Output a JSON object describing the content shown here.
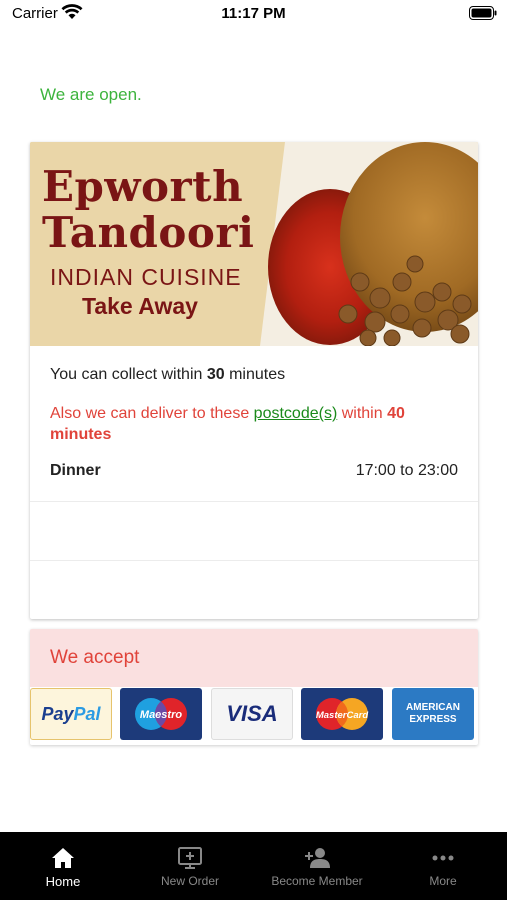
{
  "status_bar": {
    "carrier": "Carrier",
    "time": "11:17 PM"
  },
  "open_status": "We are open.",
  "restaurant": {
    "name_line1": "Epworth",
    "name_line2": "Tandoori",
    "subtitle": "INDIAN CUISINE",
    "tagline": "Take Away"
  },
  "collect": {
    "prefix": "You can collect within ",
    "minutes": "30",
    "suffix": " minutes"
  },
  "delivery": {
    "prefix": "Also we can deliver to these ",
    "link_text": "postcode(s)",
    "middle": " within ",
    "minutes": "40 minutes"
  },
  "hours": [
    {
      "label": "Dinner",
      "time": "17:00 to 23:00"
    }
  ],
  "payment": {
    "title": "We accept",
    "methods": [
      {
        "name": "PayPal",
        "part1": "Pay",
        "part2": "Pal"
      },
      {
        "name": "Maestro"
      },
      {
        "name": "VISA"
      },
      {
        "name": "MasterCard"
      },
      {
        "name": "American Express",
        "line1": "AMERICAN",
        "line2": "EXPRESS"
      }
    ]
  },
  "tabs": [
    {
      "label": "Home",
      "icon": "home-icon",
      "active": true
    },
    {
      "label": "New Order",
      "icon": "new-order-icon",
      "active": false
    },
    {
      "label": "Become Member",
      "icon": "add-person-icon",
      "active": false
    },
    {
      "label": "More",
      "icon": "more-dots-icon",
      "active": false
    }
  ],
  "colors": {
    "open_green": "#3db43d",
    "accent_red": "#e0433a",
    "link_green": "#1a8a1a",
    "brand_maroon": "#7a1515",
    "accept_bg": "#fae0e0"
  }
}
